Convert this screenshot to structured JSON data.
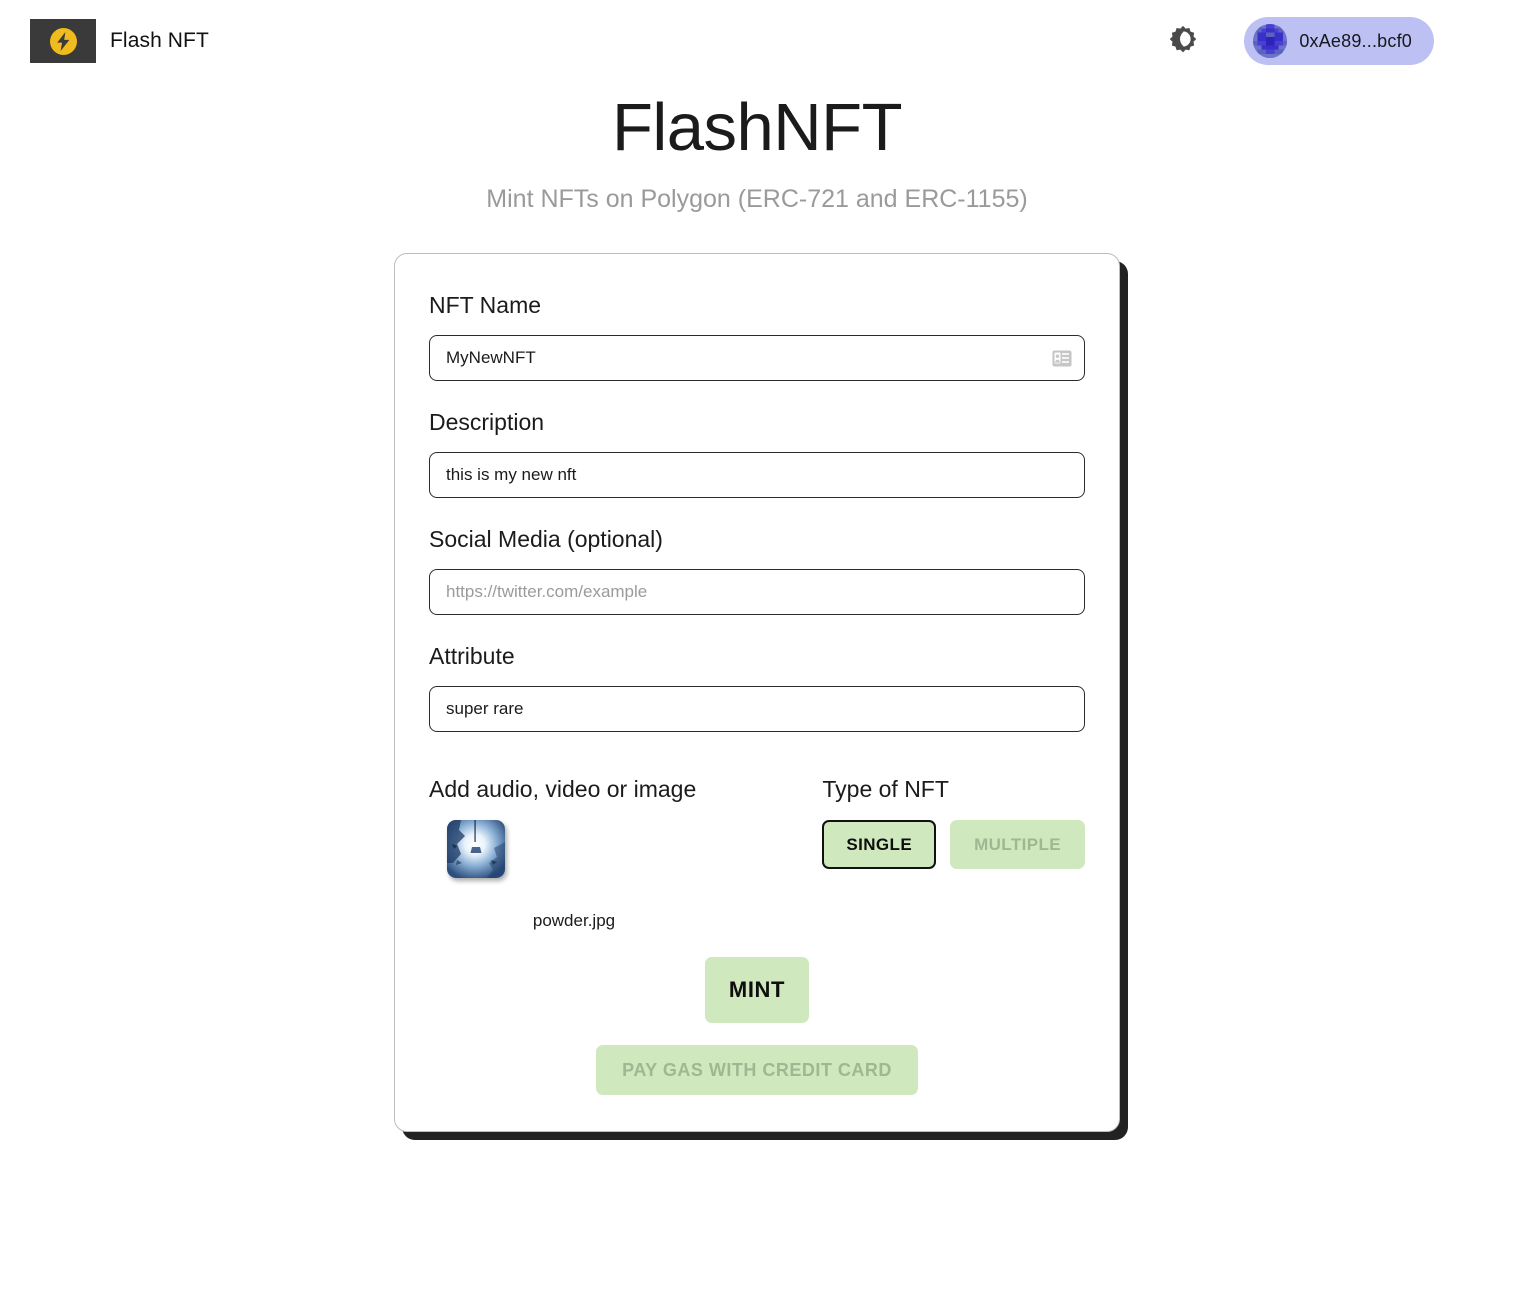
{
  "header": {
    "brand_name": "Flash NFT",
    "logo_icon": "lightning-bolt-icon",
    "theme_toggle_icon": "brightness-dark-mode-icon",
    "wallet_address": "0xAe89...bcf0",
    "wallet_avatar_icon": "blockies-avatar",
    "colors": {
      "logo_tile": "#3a3a3a",
      "logo_bolt": "#f0bb1e",
      "wallet_chip": "#bcc0f2"
    }
  },
  "hero": {
    "title": "FlashNFT",
    "subtitle": "Mint NFTs on Polygon (ERC-721 and ERC-1155)"
  },
  "form": {
    "nft_name": {
      "label": "NFT Name",
      "value": "MyNewNFT",
      "placeholder": "",
      "autofill_icon": "contact-card-icon"
    },
    "description": {
      "label": "Description",
      "value": "this is my new nft",
      "placeholder": ""
    },
    "social_media": {
      "label": "Social Media (optional)",
      "value": "",
      "placeholder": "https://twitter.com/example"
    },
    "attribute": {
      "label": "Attribute",
      "value": "super rare",
      "placeholder": ""
    },
    "media": {
      "label": "Add audio, video or image",
      "file_name": "powder.jpg",
      "thumbnail_icon": "image-thumbnail"
    },
    "nft_type": {
      "label": "Type of NFT",
      "options": [
        {
          "label": "SINGLE",
          "selected": true
        },
        {
          "label": "MULTIPLE",
          "selected": false
        }
      ]
    },
    "actions": {
      "mint_label": "MINT",
      "gas_label": "PAY GAS WITH CREDIT CARD",
      "gas_disabled": true,
      "button_color": "#cfe8bd"
    }
  }
}
